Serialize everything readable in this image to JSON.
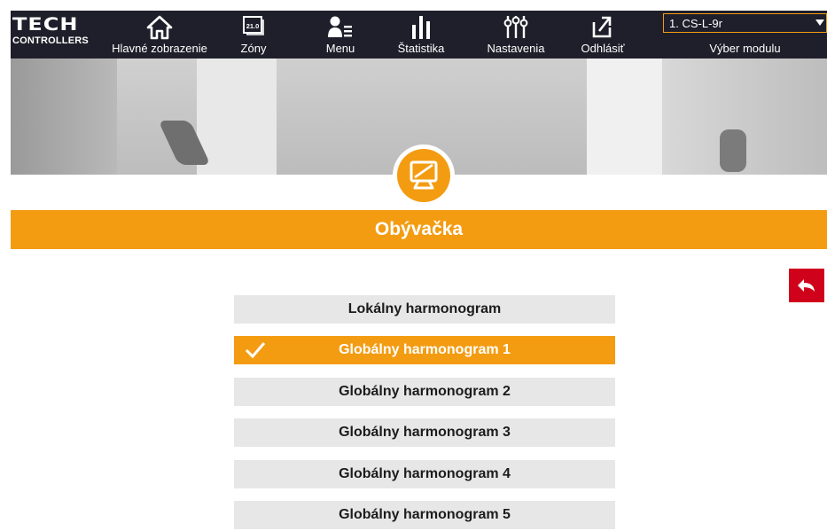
{
  "brand": {
    "logo_text": "TECH",
    "logo_sub": "CONTROLLERS"
  },
  "nav": {
    "home": {
      "label": "Hlavné zobrazenie",
      "icon": "home-icon"
    },
    "zones": {
      "label": "Zóny",
      "icon": "thermostat-display-icon",
      "icon_text": "21.0"
    },
    "menu": {
      "label": "Menu",
      "icon": "user-menu-icon"
    },
    "stats": {
      "label": "Štatistika",
      "icon": "bar-chart-icon"
    },
    "settings": {
      "label": "Nastavenia",
      "icon": "sliders-icon"
    },
    "logout": {
      "label": "Odhlásiť",
      "icon": "logout-icon"
    }
  },
  "module_select": {
    "value": "1. CS-L-9r",
    "caption": "Výber modulu"
  },
  "zone": {
    "title": "Obývačka",
    "icon": "zone-display-icon"
  },
  "back_button": {
    "icon": "back-arrow-icon"
  },
  "schedules": [
    {
      "label": "Lokálny harmonogram",
      "selected": false
    },
    {
      "label": "Globálny harmonogram 1",
      "selected": true
    },
    {
      "label": "Globálny harmonogram 2",
      "selected": false
    },
    {
      "label": "Globálny harmonogram 3",
      "selected": false
    },
    {
      "label": "Globálny harmonogram 4",
      "selected": false
    },
    {
      "label": "Globálny harmonogram 5",
      "selected": false
    }
  ],
  "colors": {
    "accent": "#f39c12",
    "nav_bg": "#1f1f2b",
    "back_button": "#d0021b",
    "option_bg": "#e7e7e7"
  }
}
